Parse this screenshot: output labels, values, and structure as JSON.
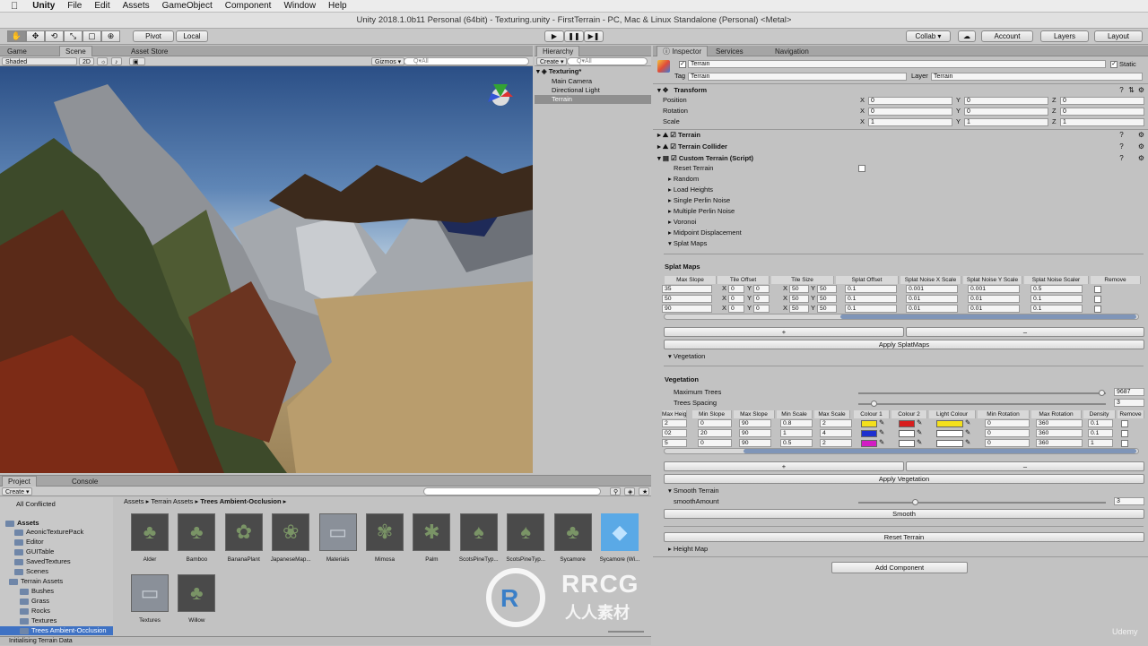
{
  "mac_menu": {
    "apple": "",
    "app": "Unity",
    "items": [
      "File",
      "Edit",
      "Assets",
      "GameObject",
      "Component",
      "Window",
      "Help"
    ]
  },
  "window_title": "Unity 2018.1.0b11 Personal (64bit) - Texturing.unity - FirstTerrain - PC, Mac & Linux Standalone (Personal) <Metal>",
  "toolbar": {
    "tools": [
      "✋",
      "✥",
      "⟲",
      "⤡",
      "▢",
      "⊕"
    ],
    "pivot": "Pivot",
    "local": "Local",
    "play": "▶",
    "pause": "❚❚",
    "step": "▶❚",
    "collab": "Collab ▾",
    "cloud": "☁",
    "account": "Account",
    "layers": "Layers",
    "layout": "Layout"
  },
  "scene_panel": {
    "tabs": [
      "Game",
      "Scene",
      "Asset Store"
    ],
    "shading": "Shaded",
    "mode_2d": "2D",
    "gizmos": "Gizmos ▾",
    "search_placeholder": "Q▾All"
  },
  "hierarchy": {
    "tab": "Hierarchy",
    "create": "Create ▾",
    "search_placeholder": "Q▾All",
    "scene": "Texturing*",
    "items": [
      "Main Camera",
      "Directional Light",
      "Terrain"
    ]
  },
  "inspector": {
    "tabs": [
      "Inspector",
      "Services",
      "Navigation"
    ],
    "object_name": "Terrain",
    "static_label": "Static",
    "tag_label": "Tag",
    "tag_value": "Terrain",
    "layer_label": "Layer",
    "layer_value": "Terrain",
    "transform": {
      "title": "Transform",
      "rows": [
        {
          "label": "Position",
          "x": "0",
          "y": "0",
          "z": "0"
        },
        {
          "label": "Rotation",
          "x": "0",
          "y": "0",
          "z": "0"
        },
        {
          "label": "Scale",
          "x": "1",
          "y": "1",
          "z": "1"
        }
      ]
    },
    "components": [
      "Terrain",
      "Terrain Collider",
      "Custom Terrain (Script)"
    ],
    "reset_terrain_label": "Reset Terrain",
    "foldouts": [
      "Random",
      "Load Heights",
      "Single Perlin Noise",
      "Multiple Perlin Noise",
      "Voronoi",
      "Midpoint Displacement",
      "Splat Maps"
    ],
    "splat": {
      "title": "Splat Maps",
      "headers": [
        "Max Slope",
        "Tile Offset",
        "Tile Size",
        "Splat Offset",
        "Splat Noise X Scale",
        "Splat Noise Y Scale",
        "Splat Noise Scaler",
        "Remove"
      ],
      "rows": [
        {
          "max_slope": "35",
          "ox": "0",
          "oy": "0",
          "sx": "50",
          "sy": "50",
          "offset": "0.1",
          "nx": "0.001",
          "ny": "0.001",
          "scaler": "0.5"
        },
        {
          "max_slope": "50",
          "ox": "0",
          "oy": "0",
          "sx": "50",
          "sy": "50",
          "offset": "0.1",
          "nx": "0.01",
          "ny": "0.01",
          "scaler": "0.1"
        },
        {
          "max_slope": "90",
          "ox": "0",
          "oy": "0",
          "sx": "50",
          "sy": "50",
          "offset": "0.1",
          "nx": "0.01",
          "ny": "0.01",
          "scaler": "0.1"
        }
      ],
      "add": "+",
      "remove": "–",
      "apply": "Apply SplatMaps"
    },
    "vegetation_foldout": "Vegetation",
    "vegetation": {
      "title": "Vegetation",
      "max_trees_label": "Maximum Trees",
      "max_trees": "9687",
      "spacing_label": "Trees Spacing",
      "spacing": "3",
      "headers": [
        "Max Height",
        "Min Slope",
        "Max Slope",
        "Min Scale",
        "Max Scale",
        "Colour 1",
        "Colour 2",
        "Light Colour",
        "Min Rotation",
        "Max Rotation",
        "Density",
        "Remove"
      ],
      "rows": [
        {
          "max_height": "2",
          "min_slope": "0",
          "max_slope": "90",
          "min_scale": "0.8",
          "max_scale": "2",
          "c1": "#f4e01c",
          "c2": "#d81e1e",
          "light": "#f4e01c",
          "min_rot": "0",
          "max_rot": "360",
          "density": "0.1"
        },
        {
          "max_height": "02",
          "min_slope": "20",
          "max_slope": "90",
          "min_scale": "1",
          "max_scale": "4",
          "c1": "#1d2fd0",
          "c2": "#ffffff",
          "light": "#ffffff",
          "min_rot": "0",
          "max_rot": "360",
          "density": "0.1"
        },
        {
          "max_height": "5",
          "min_slope": "0",
          "max_slope": "90",
          "min_scale": "0.5",
          "max_scale": "2",
          "c1": "#d21cc4",
          "c2": "#ffffff",
          "light": "#ffffff",
          "min_rot": "0",
          "max_rot": "360",
          "density": "1"
        }
      ],
      "add": "+",
      "remove": "–",
      "apply": "Apply Vegetation"
    },
    "smooth": {
      "title": "Smooth Terrain",
      "amount_label": "smoothAmount",
      "amount": "3",
      "button": "Smooth"
    },
    "reset_button": "Reset Terrain",
    "height_map": "Height Map",
    "add_component": "Add Component"
  },
  "project": {
    "tabs": [
      "Project",
      "Console"
    ],
    "create": "Create ▾",
    "tree": [
      "All Conflicted",
      "Assets",
      "AeonicTexturePack",
      "Editor",
      "GUITable",
      "SavedTextures",
      "Scenes",
      "Terrain Assets",
      "Bushes",
      "Grass",
      "Rocks",
      "Textures",
      "Trees Ambient-Occlusion"
    ],
    "breadcrumb": [
      "Assets",
      "Terrain Assets",
      "Trees Ambient-Occlusion"
    ],
    "assets": [
      "Alder",
      "Bamboo",
      "BananaPlant",
      "JapaneseMap...",
      "Materials",
      "Mimosa",
      "Palm",
      "ScotsPineTyp...",
      "ScotsPineTyp...",
      "Sycamore",
      "Sycamore (Wi...",
      "Textures",
      "Willow"
    ]
  },
  "status": "Initialising Terrain Data",
  "watermark": {
    "logo": "RRCG",
    "sub": "人人素材"
  },
  "udemy": "Udemy"
}
